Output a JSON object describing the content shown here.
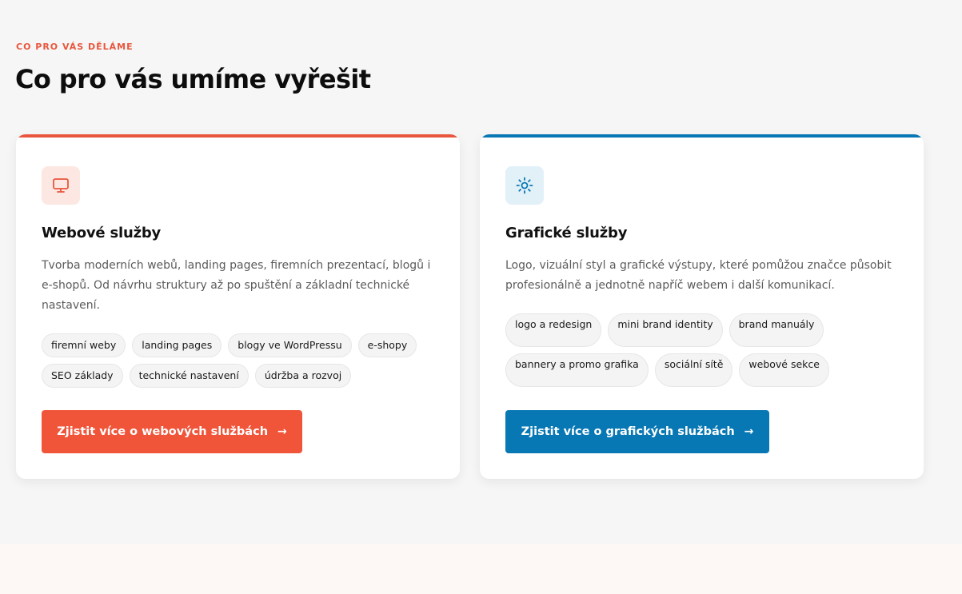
{
  "header": {
    "eyebrow": "CO PRO VÁS DĚLÁME",
    "title": "Co pro vás umíme vyřešit"
  },
  "cards": [
    {
      "icon": "monitor-icon",
      "accent": "#e8573d",
      "title": "Webové služby",
      "description": "Tvorba moderních webů, landing pages, firemních prezentací, blogů i e-shopů. Od návrhu struktury až po spuštění a základní technické nastavení.",
      "tags": [
        "firemní weby",
        "landing pages",
        "blogy ve WordPressu",
        "e-shopy",
        "SEO základy",
        "technické nastavení",
        "údržba a rozvoj"
      ],
      "cta": "Zjistit více o webových službách",
      "cta_arrow": "→"
    },
    {
      "icon": "sun-icon",
      "accent": "#0878b4",
      "title": "Grafické služby",
      "description": "Logo, vizuální styl a grafické výstupy, které pomůžou značce působit profesionálně a jednotně napříč webem i další komunikací.",
      "tags": [
        "logo a redesign",
        "mini brand identity",
        "brand manuály",
        "bannery a promo grafika",
        "sociální sítě",
        "webové sekce"
      ],
      "cta": "Zjistit více o grafických službách",
      "cta_arrow": "→"
    }
  ]
}
